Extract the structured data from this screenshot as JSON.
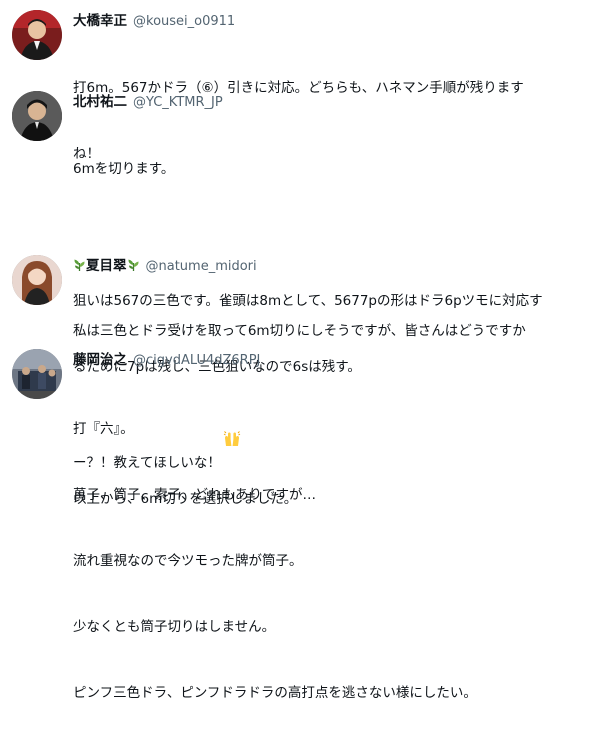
{
  "posts": [
    {
      "name": "大橋幸正",
      "handle": "@kousei_o0911",
      "lines": [
        "打6m。567かドラ（⑥）引きに対応。どちらも、ハネマン手順が残ります",
        "ね！"
      ]
    },
    {
      "name": "北村祐二",
      "handle": "@YC_KTMR_JP",
      "lines": [
        "6mを切ります。",
        "",
        "狙いは567の三色です。雀頭は8mとして、5677pの形はドラ6pツモに対応す",
        "るために7pは残し、三色狙いなので6sは残す。",
        "",
        "以上から、6m切りを選択しました。"
      ]
    },
    {
      "name": "夏目翠",
      "handle": "@natume_midori",
      "lines": [
        "私は三色とドラ受けを取って6m切りにしそうですが、皆さんはどうですか",
        "ー？！教えてほしいな！"
      ]
    },
    {
      "name": "藤岡治之",
      "handle": "@cigvdALU4dZ6RPJ",
      "lines": [
        "打『六』。",
        "萬子、筒子、索子、どれもありですが…",
        "流れ重視なので今ツモった牌が筒子。",
        "少なくとも筒子切りはしません。",
        "ピンフ三色ドラ、ピンフドラドラの高打点を逃さない様にしたい。"
      ]
    }
  ],
  "icons": {
    "leaf": "herb-emoji-icon",
    "clap": "raised-hands-emoji-icon"
  }
}
